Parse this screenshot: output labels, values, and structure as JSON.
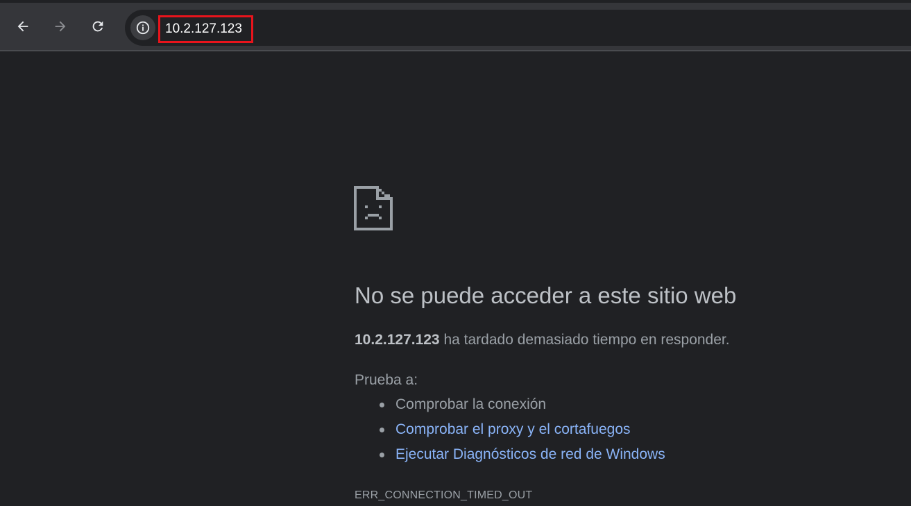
{
  "browser": {
    "url": "10.2.127.123",
    "icons": {
      "back": "back-arrow-icon",
      "forward": "forward-arrow-icon",
      "reload": "reload-icon",
      "site_info": "info-icon"
    }
  },
  "error_page": {
    "icon": "sad-page-icon",
    "headline": "No se puede acceder a este sitio web",
    "summary_host": "10.2.127.123",
    "summary_text": " ha tardado demasiado tiempo en responder.",
    "try_label": "Prueba a:",
    "suggestions": [
      {
        "label": "Comprobar la conexión",
        "is_link": false
      },
      {
        "label": "Comprobar el proxy y el cortafuegos",
        "is_link": true
      },
      {
        "label": "Ejecutar Diagnósticos de red de Windows",
        "is_link": true
      }
    ],
    "error_code": "ERR_CONNECTION_TIMED_OUT"
  },
  "colors": {
    "page_background": "#202124",
    "toolbar_background": "#35363a",
    "highlight_box": "#e8141c",
    "link": "#8ab4f8"
  }
}
